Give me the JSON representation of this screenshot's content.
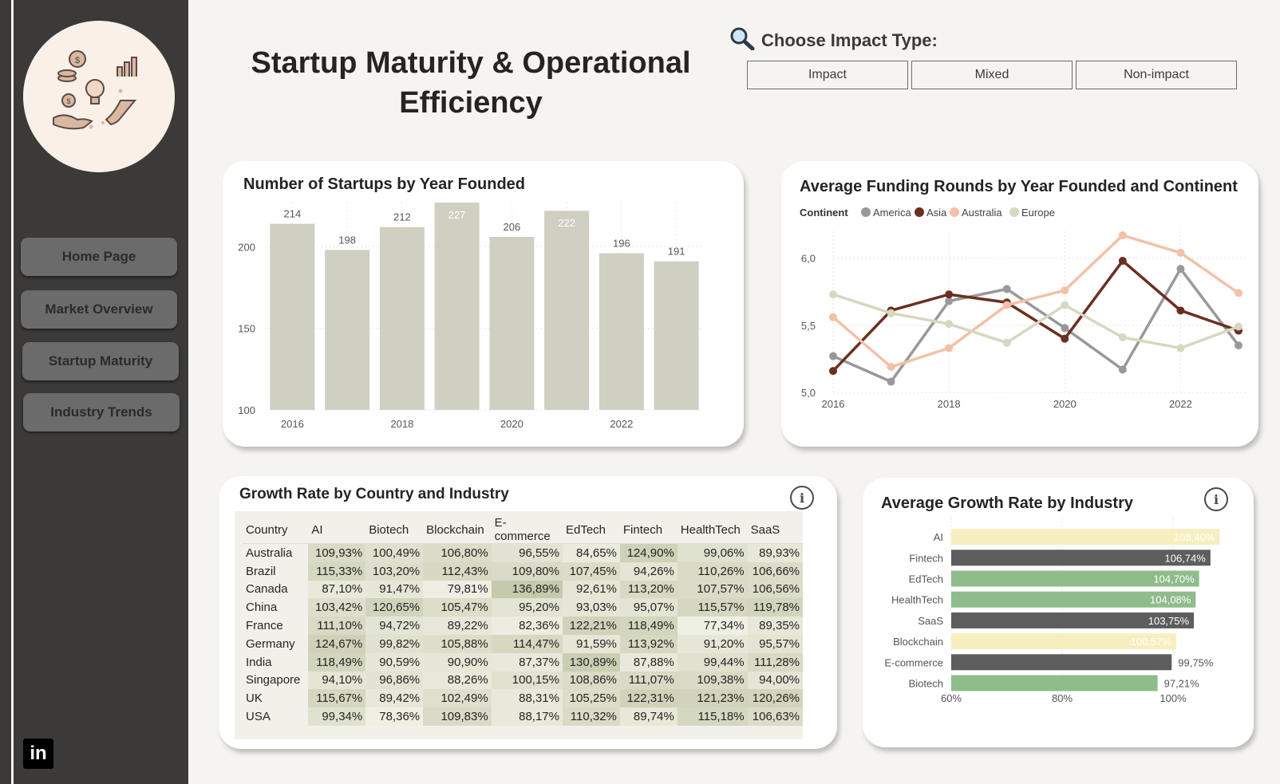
{
  "nav": {
    "items": [
      {
        "label": "Home Page"
      },
      {
        "label": "Market Overview"
      },
      {
        "label": "Startup Maturity"
      },
      {
        "label": "Industry Trends"
      }
    ],
    "linkedin_icon": "linkedin-icon"
  },
  "header": {
    "title_line1": "Startup Maturity & Operational",
    "title_line2": "Efficiency"
  },
  "filter": {
    "label": "Choose Impact Type:",
    "icon": "search-icon",
    "options": [
      "Impact",
      "Mixed",
      "Non-impact"
    ]
  },
  "colors": {
    "bar": "#cfcfc2",
    "america": "#999999",
    "asia": "#6b2f1f",
    "australia": "#f4c0a8",
    "europe": "#d4d9bf",
    "ind_yellow": "#f7efbf",
    "ind_gray": "#5d5d5d",
    "ind_green": "#8fbc8b"
  },
  "charts": {
    "startups": {
      "title": "Number of Startups by Year Founded",
      "chart_data": {
        "type": "bar",
        "categories": [
          "2016",
          "2017",
          "2018",
          "2019",
          "2020",
          "2021",
          "2022",
          "2023"
        ],
        "values": [
          214,
          198,
          212,
          227,
          206,
          222,
          196,
          191
        ],
        "xticks": [
          "2016",
          "2018",
          "2020",
          "2022"
        ],
        "yticks": [
          100,
          150,
          200
        ],
        "ylim": [
          100,
          227
        ],
        "grid": true
      }
    },
    "funding": {
      "title": "Average Funding Rounds by Year Founded and Continent",
      "legend_title": "Continent",
      "chart_data": {
        "type": "line",
        "x": [
          2016,
          2017,
          2018,
          2019,
          2020,
          2021,
          2022,
          2023
        ],
        "series": [
          {
            "name": "America",
            "values": [
              5.27,
              5.08,
              5.68,
              5.77,
              5.48,
              5.17,
              5.92,
              5.35
            ]
          },
          {
            "name": "Asia",
            "values": [
              5.16,
              5.61,
              5.73,
              5.67,
              5.4,
              5.98,
              5.61,
              5.46
            ]
          },
          {
            "name": "Australia",
            "values": [
              5.56,
              5.19,
              5.33,
              5.65,
              5.76,
              6.17,
              6.04,
              5.74
            ]
          },
          {
            "name": "Europe",
            "values": [
              5.73,
              5.59,
              5.51,
              5.37,
              5.65,
              5.41,
              5.33,
              5.49
            ]
          }
        ],
        "xticks": [
          "2016",
          "2018",
          "2020",
          "2022"
        ],
        "yticks": [
          "5,0",
          "5,5",
          "6,0"
        ],
        "ylim": [
          5.0,
          6.2
        ],
        "legend": "top-left",
        "grid": true
      }
    },
    "matrix": {
      "title": "Growth Rate by Country and Industry",
      "columns": [
        "Country",
        "AI",
        "Biotech",
        "Blockchain",
        "E-commerce",
        "EdTech",
        "Fintech",
        "HealthTech",
        "SaaS"
      ],
      "rows": [
        {
          "country": "Australia",
          "values": [
            "109,93%",
            "100,49%",
            "106,80%",
            "96,55%",
            "84,65%",
            "124,90%",
            "99,06%",
            "89,93%"
          ]
        },
        {
          "country": "Brazil",
          "values": [
            "115,33%",
            "103,20%",
            "112,43%",
            "109,80%",
            "107,45%",
            "94,26%",
            "110,26%",
            "106,66%"
          ]
        },
        {
          "country": "Canada",
          "values": [
            "87,10%",
            "91,47%",
            "79,81%",
            "136,89%",
            "92,61%",
            "113,20%",
            "107,57%",
            "106,56%"
          ]
        },
        {
          "country": "China",
          "values": [
            "103,42%",
            "120,65%",
            "105,47%",
            "95,20%",
            "93,03%",
            "95,07%",
            "115,57%",
            "119,78%"
          ]
        },
        {
          "country": "France",
          "values": [
            "111,10%",
            "94,72%",
            "89,22%",
            "82,36%",
            "122,21%",
            "118,49%",
            "77,34%",
            "89,35%"
          ]
        },
        {
          "country": "Germany",
          "values": [
            "124,67%",
            "99,82%",
            "105,88%",
            "114,47%",
            "91,59%",
            "113,92%",
            "91,20%",
            "95,57%"
          ]
        },
        {
          "country": "India",
          "values": [
            "118,49%",
            "90,59%",
            "90,90%",
            "87,37%",
            "130,89%",
            "87,88%",
            "99,44%",
            "111,28%"
          ]
        },
        {
          "country": "Singapore",
          "values": [
            "94,10%",
            "96,86%",
            "88,26%",
            "100,15%",
            "108,86%",
            "111,07%",
            "109,38%",
            "94,00%"
          ]
        },
        {
          "country": "UK",
          "values": [
            "115,67%",
            "89,42%",
            "102,49%",
            "88,31%",
            "105,25%",
            "122,31%",
            "121,23%",
            "120,26%"
          ]
        },
        {
          "country": "USA",
          "values": [
            "99,34%",
            "78,36%",
            "109,83%",
            "88,17%",
            "110,32%",
            "89,74%",
            "115,18%",
            "106,63%"
          ]
        }
      ]
    },
    "industry": {
      "title": "Average Growth Rate by Industry",
      "chart_data": {
        "type": "bar",
        "orientation": "horizontal",
        "categories": [
          "AI",
          "Fintech",
          "EdTech",
          "HealthTech",
          "SaaS",
          "Blockchain",
          "E-commerce",
          "Biotech"
        ],
        "values": [
          108.4,
          106.74,
          104.7,
          104.08,
          103.75,
          100.57,
          99.75,
          97.21
        ],
        "labels": [
          "108,40%",
          "106,74%",
          "104,70%",
          "104,08%",
          "103,75%",
          "100,57%",
          "99,75%",
          "97,21%"
        ],
        "colors": [
          "#f7efbf",
          "#5d5d5d",
          "#8fbc8b",
          "#8fbc8b",
          "#5d5d5d",
          "#f7efbf",
          "#5d5d5d",
          "#8fbc8b"
        ],
        "xticks": [
          "60%",
          "80%",
          "100%"
        ],
        "xlim": [
          60,
          110
        ]
      }
    }
  }
}
